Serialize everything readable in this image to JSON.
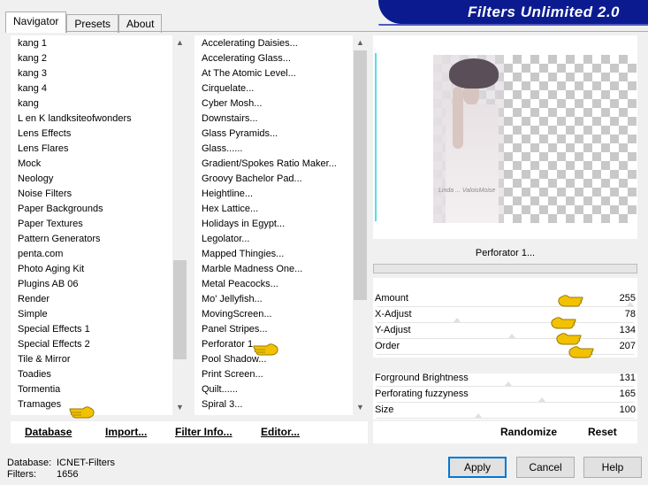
{
  "app": {
    "banner_title": "Filters Unlimited 2.0"
  },
  "tabs": [
    {
      "label": "Navigator",
      "active": true
    },
    {
      "label": "Presets",
      "active": false
    },
    {
      "label": "About",
      "active": false
    }
  ],
  "categories": {
    "items": [
      "kang 1",
      "kang 2",
      "kang 3",
      "kang 4",
      "kang",
      "L en K landksiteofwonders",
      "Lens Effects",
      "Lens Flares",
      "Mock",
      "Neology",
      "Noise Filters",
      "Paper Backgrounds",
      "Paper Textures",
      "Pattern Generators",
      "penta.com",
      "Photo Aging Kit",
      "Plugins AB 06",
      "Render",
      "Simple",
      "Special Effects 1",
      "Special Effects 2",
      "Tile & Mirror",
      "Toadies",
      "Tormentia",
      "Tramages"
    ],
    "selected": "Tramages"
  },
  "filters": {
    "items": [
      "Accelerating Daisies...",
      "Accelerating Glass...",
      "At The Atomic Level...",
      "Cirquelate...",
      "Cyber Mosh...",
      "Downstairs...",
      "Glass Pyramids...",
      "Glass......",
      "Gradient/Spokes Ratio Maker...",
      "Groovy Bachelor Pad...",
      "Heightline...",
      "Hex Lattice...",
      "Holidays in Egypt...",
      "Legolator...",
      "Mapped Thingies...",
      "Marble Madness One...",
      "Metal Peacocks...",
      "Mo' Jellyfish...",
      "MovingScreen...",
      "Panel Stripes...",
      "Perforator 1...",
      "Pool Shadow...",
      "Print Screen...",
      "Quilt......",
      "Spiral 3..."
    ],
    "selected": "Perforator 1..."
  },
  "left_buttons": {
    "database": "Database",
    "import": "Import...",
    "filter_info": "Filter Info...",
    "editor": "Editor..."
  },
  "preview": {
    "watermark": "Linda ... ValoisMoise"
  },
  "filter_title": "Perforator 1...",
  "params_group1": [
    {
      "label": "Amount",
      "value": "255",
      "level": 1.0
    },
    {
      "label": "X-Adjust",
      "value": "78",
      "level": 0.306
    },
    {
      "label": "Y-Adjust",
      "value": "134",
      "level": 0.525
    },
    {
      "label": "Order",
      "value": "207",
      "level": 0.812
    }
  ],
  "params_group2": [
    {
      "label": "Forground Brightness",
      "value": "131",
      "level": 0.514
    },
    {
      "label": "Perforating fuzzyness",
      "value": "165",
      "level": 0.647
    },
    {
      "label": "Size",
      "value": "100",
      "level": 0.392
    }
  ],
  "right_buttons": {
    "randomize": "Randomize",
    "reset": "Reset"
  },
  "status": {
    "database_label": "Database:",
    "database_value": "ICNET-Filters",
    "filters_label": "Filters:",
    "filters_value": "1656"
  },
  "dialog_buttons": {
    "apply": "Apply",
    "cancel": "Cancel",
    "help": "Help"
  },
  "colors": {
    "banner": "#0b1b8f",
    "accent": "#0078d7",
    "pointer_hand": "#f2c200"
  }
}
